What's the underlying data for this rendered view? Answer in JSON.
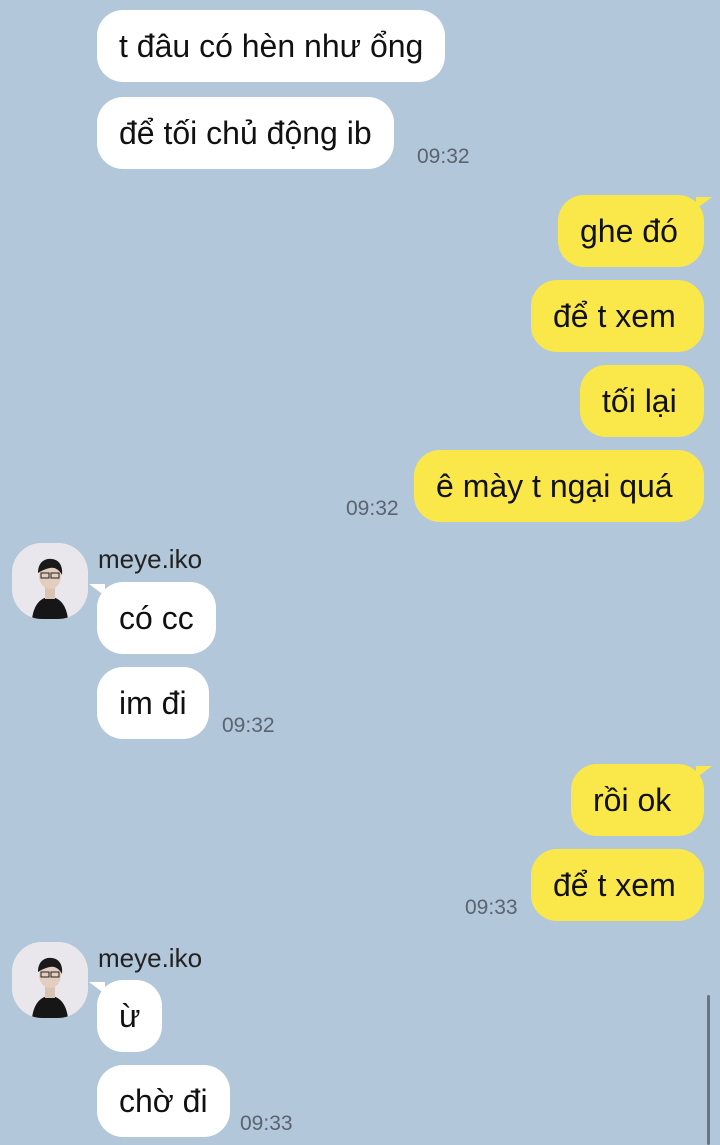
{
  "messages": {
    "m1": "t đâu có hèn như ổng",
    "m2": "để tối chủ động ib",
    "t1": "09:32",
    "m3": "ghe đó",
    "m4": "để t xem",
    "m5": "tối lại",
    "m6": "ê mày t ngại quá",
    "t2": "09:32",
    "sender1": "meye.iko",
    "m7": "có cc",
    "m8": "im đi",
    "t3": "09:32",
    "m9": "rồi ok",
    "m10": "để t xem",
    "t4": "09:33",
    "sender2": "meye.iko",
    "m11": "ừ",
    "m12": "chờ đi",
    "t5": "09:33"
  },
  "avatar": {
    "icon": "user-avatar-photo"
  },
  "colors": {
    "background": "#b2c7da",
    "outgoing": "#fae84a",
    "incoming": "#ffffff"
  }
}
